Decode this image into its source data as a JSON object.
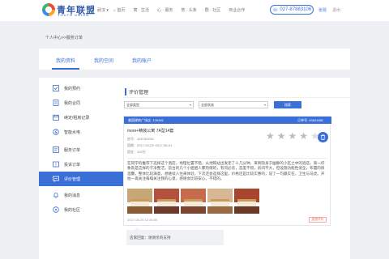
{
  "header": {
    "logo_cn": "青年联盟",
    "logo_en": "YOUTH UNION",
    "city": "武汉",
    "nav": [
      {
        "label": "首页",
        "active": true
      },
      {
        "label": "寓 · 生活",
        "active": false
      },
      {
        "label": "心 · 服务",
        "active": false
      },
      {
        "label": "势 · 头条",
        "active": false
      },
      {
        "label": "群 · 社区",
        "active": false
      },
      {
        "label": "商业合作",
        "active": false
      }
    ],
    "phone": "027-87883106",
    "user": "张昆",
    "logout": "退出"
  },
  "breadcrumb": "个人中心>>服务订单",
  "tabs": [
    {
      "label": "我的资料",
      "active": true
    },
    {
      "label": "我的空间",
      "active": false
    },
    {
      "label": "我的账户",
      "active": false
    }
  ],
  "sidebar": {
    "items": [
      {
        "label": "我的预约",
        "icon": "checklist-icon",
        "active": false
      },
      {
        "label": "我的合同",
        "icon": "contract-icon",
        "active": false
      },
      {
        "label": "续定/租房记录",
        "icon": "calendar-icon",
        "active": false
      },
      {
        "label": "智能水电",
        "icon": "water-electric-icon",
        "active": false
      },
      {
        "label": "服务订单",
        "icon": "service-order-icon",
        "active": false
      },
      {
        "label": "投诉订单",
        "icon": "complaint-icon",
        "active": false
      },
      {
        "label": "评价管理",
        "icon": "review-icon",
        "active": true
      },
      {
        "label": "我的消息",
        "icon": "bell-icon",
        "active": false
      },
      {
        "label": "我的社区",
        "icon": "community-icon",
        "active": false
      }
    ]
  },
  "main": {
    "title": "评价管理",
    "filters": {
      "type": "全部类型",
      "status": "全部状态",
      "search": "搜索"
    }
  },
  "review": {
    "hotel": "美国建筑广场店",
    "room_no": "12A301",
    "order_no": "订单号: 20641881",
    "room": "more+精装公寓   7A型14套",
    "meta": [
      "房号：43378/0091",
      "租期：2017-04-23~2017-06-01",
      "租金：102元"
    ],
    "rating": 4,
    "max_rating": 5,
    "comment": "在同学的推荐下选择这个酒店，地理位置不错，从地铁站出发走了十几分钟，来到隐身于幽静的小区之中的酒店，第一印象就是这样的干净整洁，前台的几个小姐姐人都热情的，有问必答，态度不错，房间不大，但设施功能性很全，布置的很温馨，整体比较满意，想继续入住来体验，下次还会选择这里，价格还是比较实惠的，说了一句最实在，卫生与马虎。开始一再关注每每关注我的心意，感谢会比较安心，不错的。",
    "date": "2017-08-29 12:30:00",
    "status": "追加评价",
    "reply": "店家回复：谢谢亲的支持"
  },
  "colors": {
    "accent": "#3b6fd8",
    "star_empty": "#b7bbc4",
    "badge": "#e06a5f"
  }
}
